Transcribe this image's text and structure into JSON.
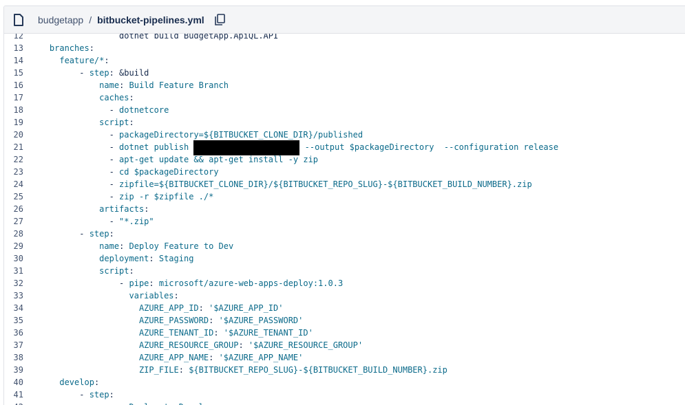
{
  "header": {
    "repo": "budgetapp",
    "separator": "/",
    "file": "bitbucket-pipelines.yml",
    "file_icon": "file-icon",
    "copy_icon": "copy-icon"
  },
  "code": {
    "lines": [
      {
        "n": "12",
        "parts": [
          {
            "t": "                  dotnet build BudgetApp.ApiQL.API",
            "c": "v"
          }
        ]
      },
      {
        "n": "13",
        "parts": [
          {
            "t": "    ",
            "c": "v"
          },
          {
            "t": "branches",
            "c": "k"
          },
          {
            "t": ":",
            "c": "v"
          }
        ]
      },
      {
        "n": "14",
        "parts": [
          {
            "t": "      ",
            "c": "v"
          },
          {
            "t": "feature/*",
            "c": "k"
          },
          {
            "t": ":",
            "c": "v"
          }
        ]
      },
      {
        "n": "15",
        "parts": [
          {
            "t": "          - ",
            "c": "v"
          },
          {
            "t": "step",
            "c": "k"
          },
          {
            "t": ": &build",
            "c": "v"
          }
        ]
      },
      {
        "n": "16",
        "parts": [
          {
            "t": "              ",
            "c": "v"
          },
          {
            "t": "name",
            "c": "k"
          },
          {
            "t": ": ",
            "c": "v"
          },
          {
            "t": "Build Feature Branch",
            "c": "k"
          }
        ]
      },
      {
        "n": "17",
        "parts": [
          {
            "t": "              ",
            "c": "v"
          },
          {
            "t": "caches",
            "c": "k"
          },
          {
            "t": ":",
            "c": "v"
          }
        ]
      },
      {
        "n": "18",
        "parts": [
          {
            "t": "                - ",
            "c": "v"
          },
          {
            "t": "dotnetcore",
            "c": "k"
          }
        ]
      },
      {
        "n": "19",
        "parts": [
          {
            "t": "              ",
            "c": "v"
          },
          {
            "t": "script",
            "c": "k"
          },
          {
            "t": ":",
            "c": "v"
          }
        ]
      },
      {
        "n": "20",
        "parts": [
          {
            "t": "                - ",
            "c": "v"
          },
          {
            "t": "packageDirectory=${BITBUCKET_CLONE_DIR}/published",
            "c": "k"
          }
        ]
      },
      {
        "n": "21",
        "parts": [
          {
            "t": "                - ",
            "c": "v"
          },
          {
            "t": "dotnet publish ",
            "c": "k"
          },
          {
            "t": "",
            "c": "redact"
          },
          {
            "t": " --output $packageDirectory  --configuration release",
            "c": "k"
          }
        ]
      },
      {
        "n": "22",
        "parts": [
          {
            "t": "                - ",
            "c": "v"
          },
          {
            "t": "apt-get update && apt-get install -y zip",
            "c": "k"
          }
        ]
      },
      {
        "n": "23",
        "parts": [
          {
            "t": "                - ",
            "c": "v"
          },
          {
            "t": "cd $packageDirectory",
            "c": "k"
          }
        ]
      },
      {
        "n": "24",
        "parts": [
          {
            "t": "                - ",
            "c": "v"
          },
          {
            "t": "zipfile=${BITBUCKET_CLONE_DIR}/${BITBUCKET_REPO_SLUG}-${BITBUCKET_BUILD_NUMBER}.zip",
            "c": "k"
          }
        ]
      },
      {
        "n": "25",
        "parts": [
          {
            "t": "                - ",
            "c": "v"
          },
          {
            "t": "zip -r $zipfile ./*",
            "c": "k"
          }
        ]
      },
      {
        "n": "26",
        "parts": [
          {
            "t": "              ",
            "c": "v"
          },
          {
            "t": "artifacts",
            "c": "k"
          },
          {
            "t": ":",
            "c": "v"
          }
        ]
      },
      {
        "n": "27",
        "parts": [
          {
            "t": "                - ",
            "c": "v"
          },
          {
            "t": "\"*.zip\"",
            "c": "k"
          }
        ]
      },
      {
        "n": "28",
        "parts": [
          {
            "t": "          - ",
            "c": "v"
          },
          {
            "t": "step",
            "c": "k"
          },
          {
            "t": ":",
            "c": "v"
          }
        ]
      },
      {
        "n": "29",
        "parts": [
          {
            "t": "              ",
            "c": "v"
          },
          {
            "t": "name",
            "c": "k"
          },
          {
            "t": ": ",
            "c": "v"
          },
          {
            "t": "Deploy Feature to Dev",
            "c": "k"
          }
        ]
      },
      {
        "n": "30",
        "parts": [
          {
            "t": "              ",
            "c": "v"
          },
          {
            "t": "deployment",
            "c": "k"
          },
          {
            "t": ": ",
            "c": "v"
          },
          {
            "t": "Staging",
            "c": "k"
          }
        ]
      },
      {
        "n": "31",
        "parts": [
          {
            "t": "              ",
            "c": "v"
          },
          {
            "t": "script",
            "c": "k"
          },
          {
            "t": ":",
            "c": "v"
          }
        ]
      },
      {
        "n": "32",
        "parts": [
          {
            "t": "                  - ",
            "c": "v"
          },
          {
            "t": "pipe",
            "c": "k"
          },
          {
            "t": ": ",
            "c": "v"
          },
          {
            "t": "microsoft/azure-web-apps-deploy:1.0.3",
            "c": "k"
          }
        ]
      },
      {
        "n": "33",
        "parts": [
          {
            "t": "                    ",
            "c": "v"
          },
          {
            "t": "variables",
            "c": "k"
          },
          {
            "t": ":",
            "c": "v"
          }
        ]
      },
      {
        "n": "34",
        "parts": [
          {
            "t": "                      ",
            "c": "v"
          },
          {
            "t": "AZURE_APP_ID",
            "c": "k"
          },
          {
            "t": ": ",
            "c": "v"
          },
          {
            "t": "'$AZURE_APP_ID'",
            "c": "k"
          }
        ]
      },
      {
        "n": "35",
        "parts": [
          {
            "t": "                      ",
            "c": "v"
          },
          {
            "t": "AZURE_PASSWORD",
            "c": "k"
          },
          {
            "t": ": ",
            "c": "v"
          },
          {
            "t": "'$AZURE_PASSWORD'",
            "c": "k"
          }
        ]
      },
      {
        "n": "36",
        "parts": [
          {
            "t": "                      ",
            "c": "v"
          },
          {
            "t": "AZURE_TENANT_ID",
            "c": "k"
          },
          {
            "t": ": ",
            "c": "v"
          },
          {
            "t": "'$AZURE_TENANT_ID'",
            "c": "k"
          }
        ]
      },
      {
        "n": "37",
        "parts": [
          {
            "t": "                      ",
            "c": "v"
          },
          {
            "t": "AZURE_RESOURCE_GROUP",
            "c": "k"
          },
          {
            "t": ": ",
            "c": "v"
          },
          {
            "t": "'$AZURE_RESOURCE_GROUP'",
            "c": "k"
          }
        ]
      },
      {
        "n": "38",
        "parts": [
          {
            "t": "                      ",
            "c": "v"
          },
          {
            "t": "AZURE_APP_NAME",
            "c": "k"
          },
          {
            "t": ": ",
            "c": "v"
          },
          {
            "t": "'$AZURE_APP_NAME'",
            "c": "k"
          }
        ]
      },
      {
        "n": "39",
        "parts": [
          {
            "t": "                      ",
            "c": "v"
          },
          {
            "t": "ZIP_FILE",
            "c": "k"
          },
          {
            "t": ": ",
            "c": "v"
          },
          {
            "t": "${BITBUCKET_REPO_SLUG}-${BITBUCKET_BUILD_NUMBER}.zip",
            "c": "k"
          }
        ]
      },
      {
        "n": "40",
        "parts": [
          {
            "t": "      ",
            "c": "v"
          },
          {
            "t": "develop",
            "c": "k"
          },
          {
            "t": ":",
            "c": "v"
          }
        ]
      },
      {
        "n": "41",
        "parts": [
          {
            "t": "          - ",
            "c": "v"
          },
          {
            "t": "step",
            "c": "k"
          },
          {
            "t": ":",
            "c": "v"
          }
        ]
      },
      {
        "n": "42",
        "parts": [
          {
            "t": "              ",
            "c": "v"
          },
          {
            "t": "name",
            "c": "k"
          },
          {
            "t": ": ",
            "c": "v"
          },
          {
            "t": "Deploy to Develop",
            "c": "k"
          }
        ]
      }
    ]
  }
}
